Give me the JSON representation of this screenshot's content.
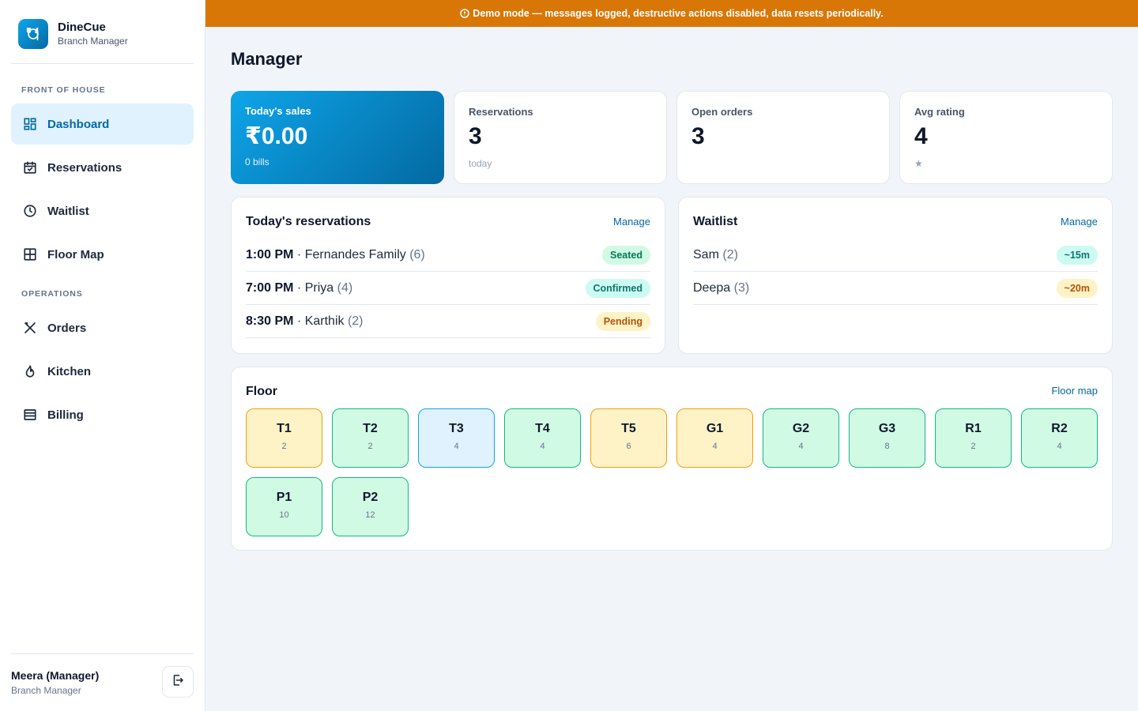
{
  "brand": {
    "name": "DineCue",
    "subtitle": "Branch Manager"
  },
  "sidebar": {
    "sections": [
      {
        "label": "FRONT OF HOUSE"
      },
      {
        "label": "OPERATIONS"
      }
    ],
    "items": [
      {
        "label": "Dashboard",
        "icon": "dashboard-icon",
        "active": true
      },
      {
        "label": "Reservations",
        "icon": "calendar-icon"
      },
      {
        "label": "Waitlist",
        "icon": "clock-icon"
      },
      {
        "label": "Floor Map",
        "icon": "grid-icon"
      },
      {
        "label": "Orders",
        "icon": "utensils-icon"
      },
      {
        "label": "Kitchen",
        "icon": "flame-icon"
      },
      {
        "label": "Billing",
        "icon": "billing-icon"
      }
    ],
    "user": {
      "name": "Meera (Manager)",
      "role": "Branch Manager"
    }
  },
  "banner": {
    "text": "Demo mode — messages logged, destructive actions disabled, data resets periodically."
  },
  "page": {
    "title": "Manager"
  },
  "stats": [
    {
      "label": "Today's sales",
      "value": "₹0.00",
      "sub": "0 bills"
    },
    {
      "label": "Reservations",
      "value": "3",
      "sub": "today"
    },
    {
      "label": "Open orders",
      "value": "3",
      "sub": ""
    },
    {
      "label": "Avg rating",
      "value": "4",
      "sub": "★"
    }
  ],
  "reservations": {
    "title": "Today's reservations",
    "link": "Manage",
    "rows": [
      {
        "time": "1:00 PM",
        "sep": "·",
        "name": "Fernandes Family",
        "party": "(6)",
        "status": "Seated"
      },
      {
        "time": "7:00 PM",
        "sep": "·",
        "name": "Priya",
        "party": "(4)",
        "status": "Confirmed"
      },
      {
        "time": "8:30 PM",
        "sep": "·",
        "name": "Karthik",
        "party": "(2)",
        "status": "Pending"
      }
    ]
  },
  "waitlist": {
    "title": "Waitlist",
    "link": "Manage",
    "rows": [
      {
        "name": "Sam",
        "party": "(2)",
        "wait": "~15m"
      },
      {
        "name": "Deepa",
        "party": "(3)",
        "wait": "~20m"
      }
    ]
  },
  "floor": {
    "title": "Floor",
    "link": "Floor map",
    "tables": [
      {
        "name": "T1",
        "seats": "2",
        "status": "amber"
      },
      {
        "name": "T2",
        "seats": "2",
        "status": "green"
      },
      {
        "name": "T3",
        "seats": "4",
        "status": "blue"
      },
      {
        "name": "T4",
        "seats": "4",
        "status": "green"
      },
      {
        "name": "T5",
        "seats": "6",
        "status": "amber"
      },
      {
        "name": "G1",
        "seats": "4",
        "status": "amber"
      },
      {
        "name": "G2",
        "seats": "4",
        "status": "green"
      },
      {
        "name": "G3",
        "seats": "8",
        "status": "green"
      },
      {
        "name": "R1",
        "seats": "2",
        "status": "green"
      },
      {
        "name": "R2",
        "seats": "4",
        "status": "green"
      },
      {
        "name": "P1",
        "seats": "10",
        "status": "green"
      },
      {
        "name": "P2",
        "seats": "12",
        "status": "green"
      }
    ]
  },
  "colors": {
    "accent": "#0369a1",
    "banner": "#d97706",
    "active_nav_bg": "#e0f2fe"
  }
}
